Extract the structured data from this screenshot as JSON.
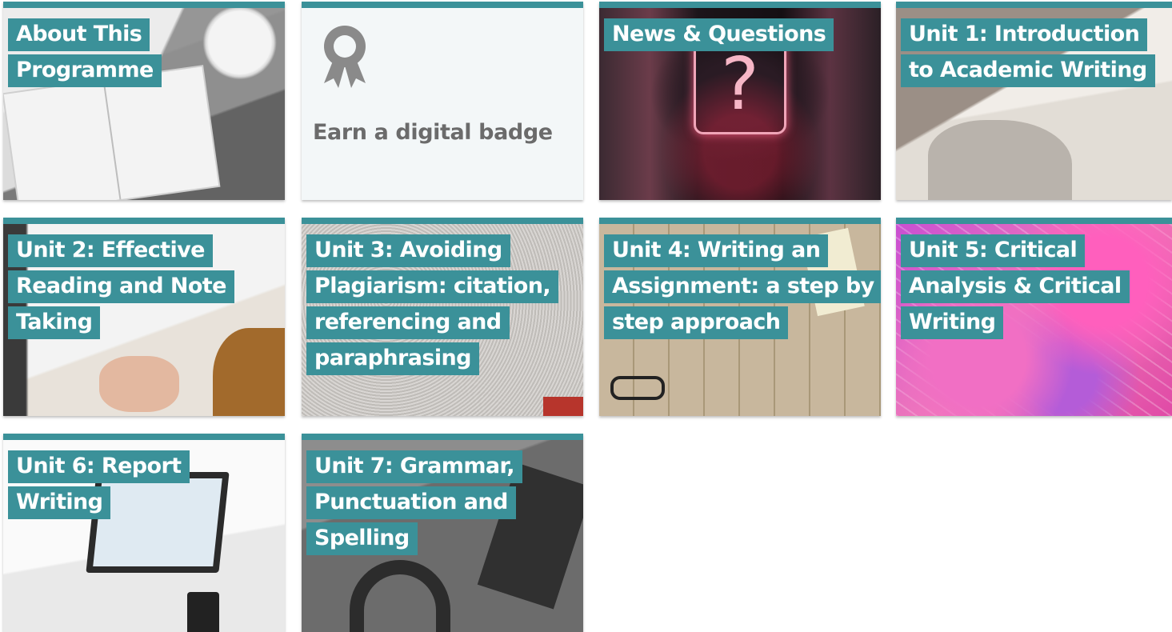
{
  "tiles": {
    "about": {
      "title": "About This Programme"
    },
    "badge": {
      "label": "Earn a digital badge",
      "icon": "award-ribbon-icon"
    },
    "news": {
      "title": "News & Questions"
    },
    "unit1": {
      "title": "Unit 1: Introduction to Academic Writing"
    },
    "unit2": {
      "title": "Unit 2: Effective Reading and Note Taking"
    },
    "unit3": {
      "title": "Unit 3: Avoiding Plagiarism: citation, referencing and paraphrasing"
    },
    "unit4": {
      "title": "Unit 4: Writing an Assignment: a step by step approach"
    },
    "unit5": {
      "title": "Unit 5: Critical Analysis & Critical Writing"
    },
    "unit6": {
      "title": "Unit 6: Report Writing"
    },
    "unit7": {
      "title": "Unit 7: Grammar, Punctuation and Spelling"
    }
  },
  "colors": {
    "accent": "#3b9199",
    "badge_bg": "#f3f7f8",
    "badge_text": "#6b6b6b"
  }
}
